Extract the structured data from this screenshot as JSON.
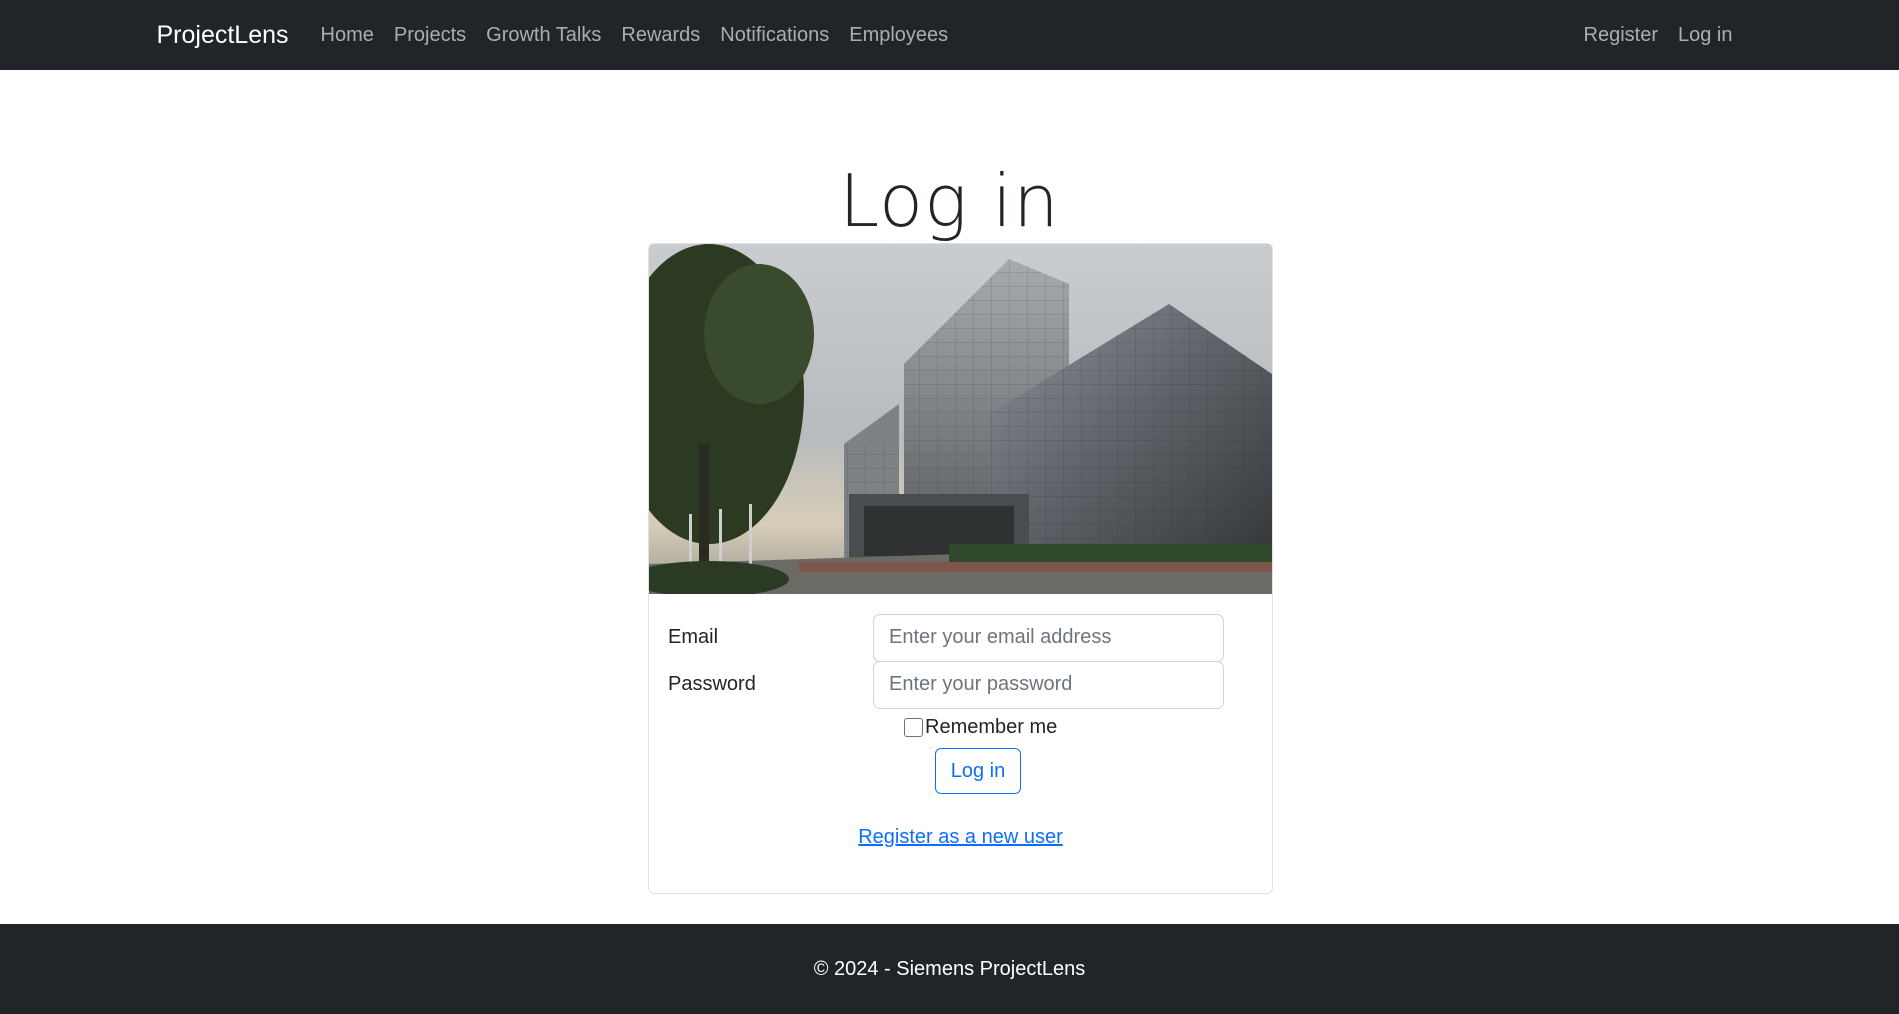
{
  "nav": {
    "brand": "ProjectLens",
    "links": [
      "Home",
      "Projects",
      "Growth Talks",
      "Rewards",
      "Notifications",
      "Employees"
    ],
    "right_links": [
      "Register",
      "Log in"
    ]
  },
  "page": {
    "title": "Log in"
  },
  "form": {
    "email_label": "Email",
    "email_placeholder": "Enter your email address",
    "password_label": "Password",
    "password_placeholder": "Enter your password",
    "remember_label": "Remember me",
    "submit_label": "Log in",
    "register_link": "Register as a new user"
  },
  "footer": {
    "text": "© 2024 - Siemens ProjectLens"
  },
  "colors": {
    "navbar_bg": "#212529",
    "link_primary": "#0d6efd"
  }
}
